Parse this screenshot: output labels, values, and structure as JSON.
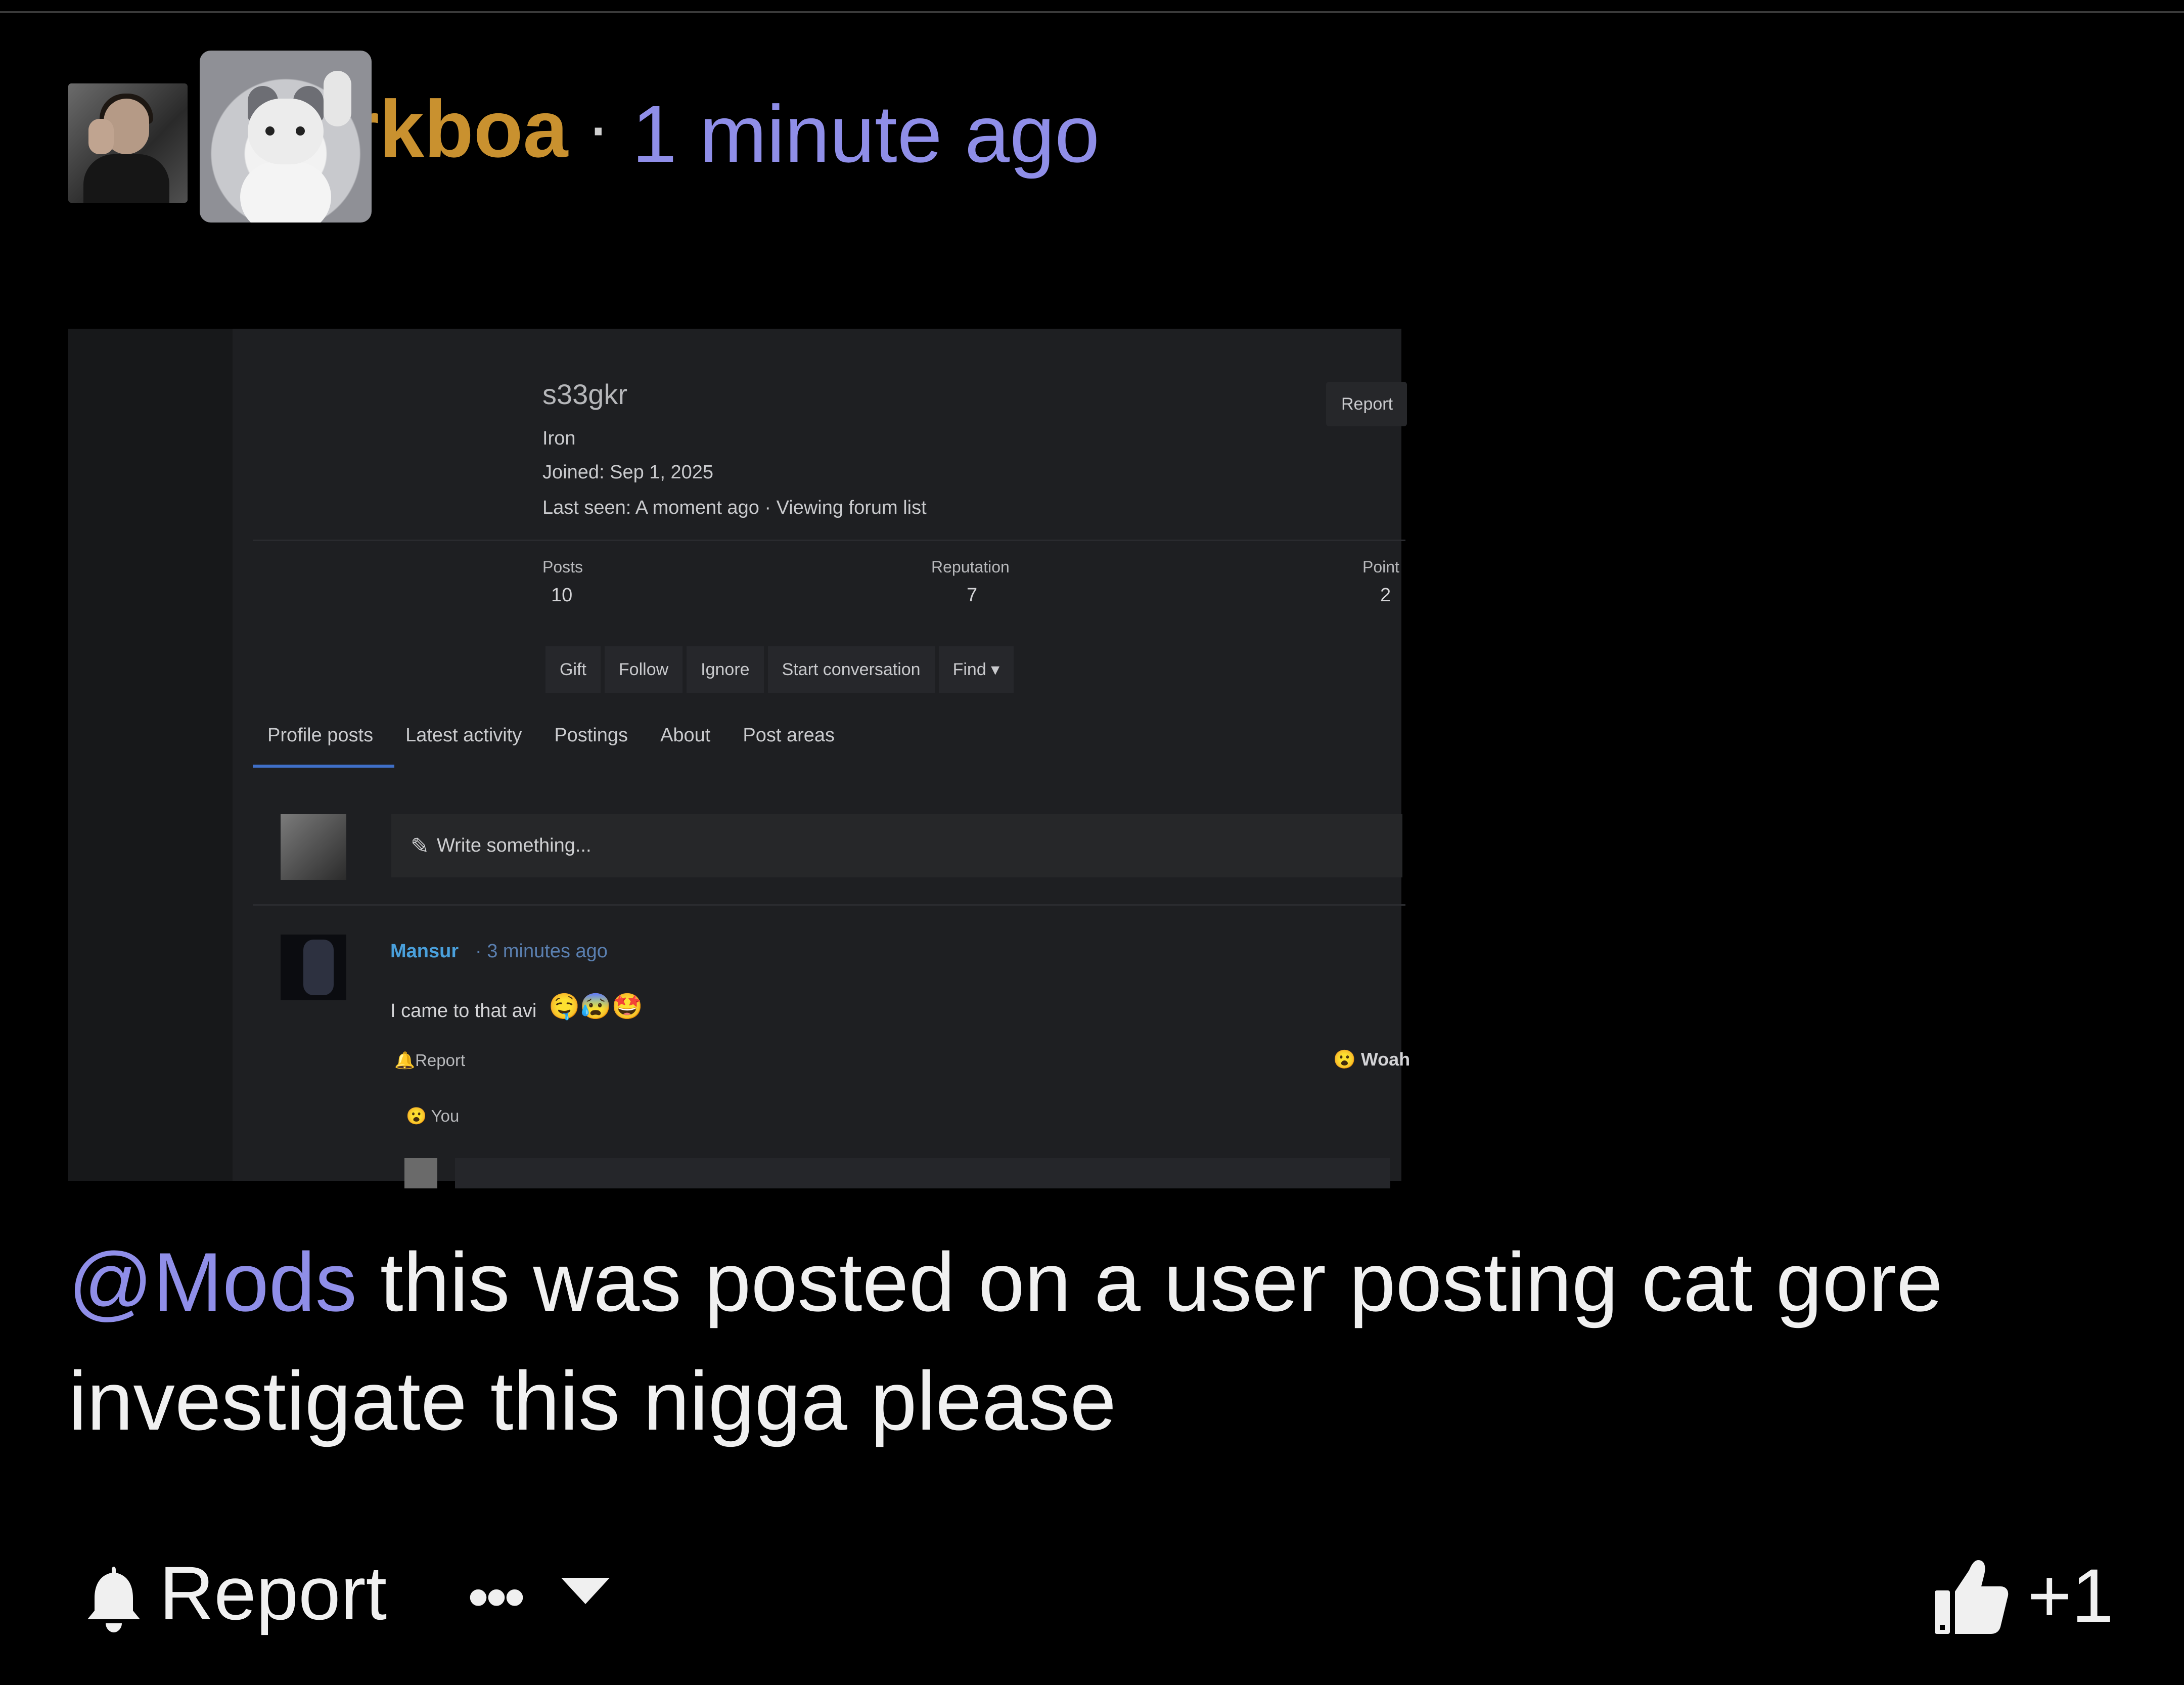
{
  "post": {
    "username": "sharkboa",
    "separator": "·",
    "time": "1 minute ago"
  },
  "embedded": {
    "profile_name": "s33gkr",
    "rank": "Iron",
    "joined": "Joined: Sep 1, 2025",
    "last_seen": "Last seen: A moment ago · Viewing forum list",
    "report_button": "Report",
    "stats": [
      {
        "label": "Posts",
        "value": "10"
      },
      {
        "label": "Reputation",
        "value": "7"
      },
      {
        "label": "Point",
        "value": "2"
      }
    ],
    "actions": [
      "Gift",
      "Follow",
      "Ignore",
      "Start conversation",
      "Find ▾"
    ],
    "tabs": [
      "Profile posts",
      "Latest activity",
      "Postings",
      "About",
      "Post areas"
    ],
    "write_placeholder": "Write something...",
    "comment": {
      "author": "Mansur",
      "time": "· 3 minutes ago",
      "text": "I came to that avi",
      "emoji": "🤤😰🤩",
      "report": "Report",
      "reaction": "😮 Woah",
      "reacted_by": "😮 You"
    }
  },
  "message": {
    "mention": "@Mods",
    "text": " this was posted on a user posting cat gore investigate this nigga please"
  },
  "footer": {
    "report_label": "Report",
    "more_label": "•••",
    "likes": "+1"
  }
}
